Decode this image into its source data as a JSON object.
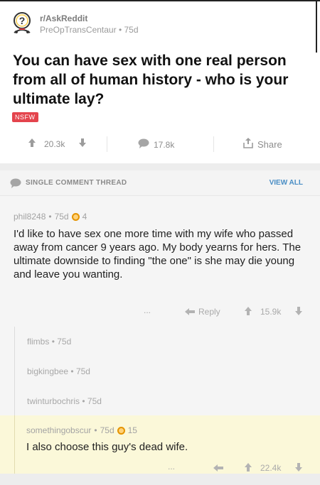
{
  "post": {
    "subreddit": "r/AskReddit",
    "author": "PreOpTransCentaur",
    "age": "75d",
    "title": "You can have sex with one real person from all of human history - who is your ultimate lay?",
    "nsfw_label": "NSFW",
    "upvotes": "20.3k",
    "comments": "17.8k",
    "share_label": "Share"
  },
  "thread": {
    "label": "SINGLE COMMENT THREAD",
    "view_all": "VIEW ALL"
  },
  "top_comment": {
    "author": "phil8248",
    "age": "75d",
    "awards": "4",
    "body": "I'd like to have sex one more time with my wife who passed away from cancer 9 years ago.  My body yearns for hers.  The ultimate downside to finding \"the one\" is she may die young and leave you wanting.",
    "more": "...",
    "reply_label": "Reply",
    "score": "15.9k"
  },
  "collapsed": [
    {
      "author": "flimbs",
      "age": "75d"
    },
    {
      "author": "bigkingbee",
      "age": "75d"
    },
    {
      "author": "twinturbochris",
      "age": "75d"
    }
  ],
  "highlighted_comment": {
    "author": "somethingobscur",
    "age": "75d",
    "awards": "15",
    "body": "I also choose this guy's dead wife.",
    "more": "...",
    "score": "22.4k"
  },
  "separator": "•"
}
